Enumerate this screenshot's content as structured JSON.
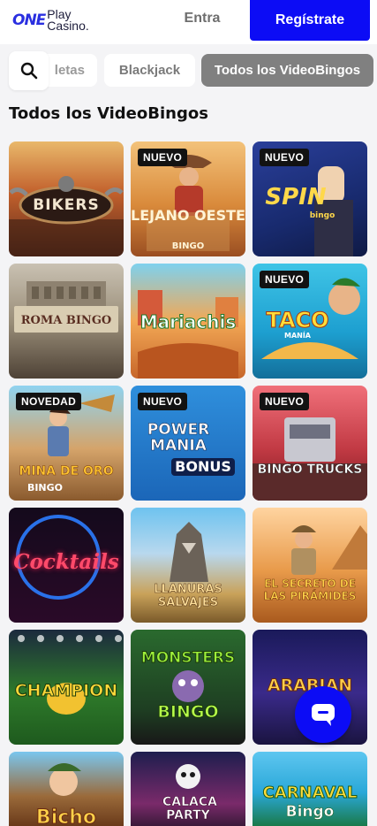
{
  "header": {
    "logo_one": "ONE",
    "logo_play": "Play",
    "logo_casino": "Casino.",
    "login_label": "Entra",
    "register_label": "Regístrate"
  },
  "filters": {
    "search_icon": "search-icon",
    "chips": [
      {
        "label": "letas"
      },
      {
        "label": "Blackjack"
      },
      {
        "label": "Todos los VideoBingos",
        "active": true
      }
    ]
  },
  "section": {
    "title": "Todos los VideoBingos"
  },
  "games": [
    {
      "name": "BIKERS",
      "badge": ""
    },
    {
      "name": "LEJANO OESTE",
      "sub": "BINGO",
      "badge": "NUEVO"
    },
    {
      "name": "SPIN",
      "sub": "bingo",
      "badge": "NUEVO"
    },
    {
      "name": "ROMA BINGO",
      "badge": ""
    },
    {
      "name": "Mariachis",
      "badge": ""
    },
    {
      "name": "TACO",
      "sub": "MANÍA",
      "badge": "NUEVO"
    },
    {
      "name": "MINA DE ORO",
      "sub": "BINGO",
      "badge": "NOVEDAD"
    },
    {
      "name": "POWER MANIA",
      "sub": "BONUS",
      "badge": "NUEVO"
    },
    {
      "name": "BINGO TRUCKS",
      "badge": "NUEVO"
    },
    {
      "name": "Cocktails",
      "badge": ""
    },
    {
      "name": "LLANURAS SALVAJES",
      "badge": ""
    },
    {
      "name": "EL SECRETO DE LAS PIRÁMIDES",
      "badge": ""
    },
    {
      "name": "CHAMPION",
      "badge": ""
    },
    {
      "name": "MONSTERS",
      "sub": "BINGO",
      "badge": ""
    },
    {
      "name": "ARABIAN",
      "badge": ""
    },
    {
      "name": "Bicho",
      "badge": ""
    },
    {
      "name": "CALACA PARTY",
      "badge": ""
    },
    {
      "name": "CARNAVAL",
      "sub": "Bingo",
      "badge": ""
    }
  ],
  "chat": {
    "icon": "chat-icon"
  },
  "colors": {
    "brand": "#0c0cf5",
    "active_chip": "#808080",
    "badge_bg": "#121212"
  }
}
